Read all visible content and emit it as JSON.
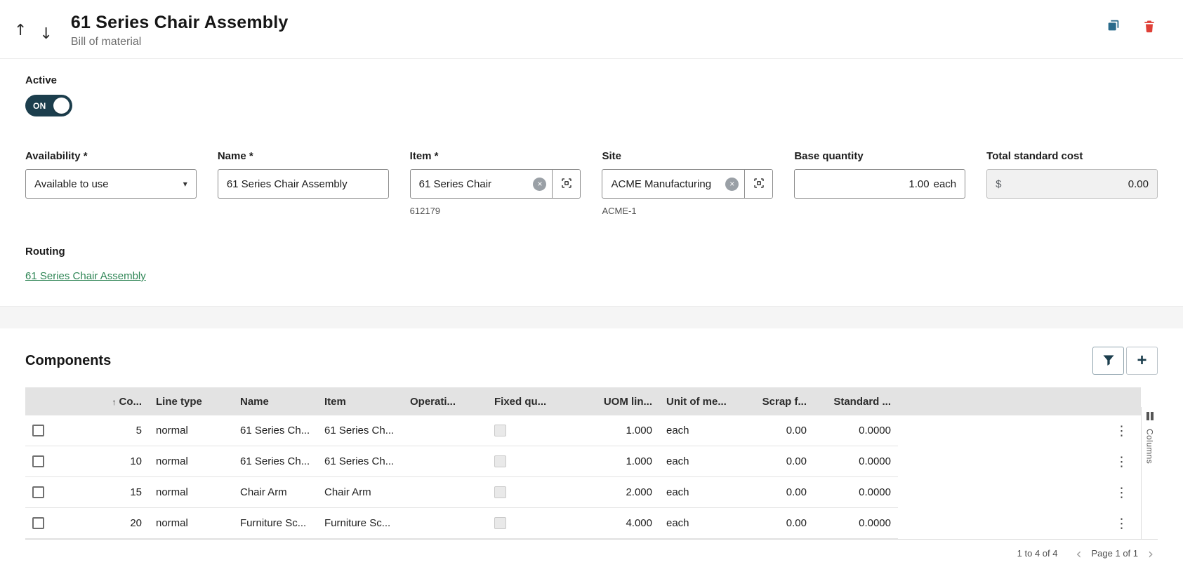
{
  "header": {
    "title": "61 Series Chair Assembly",
    "subtitle": "Bill of material"
  },
  "icons": {
    "up_arrow": "↑",
    "down_arrow": "↓",
    "select_chevron": "▾",
    "clear_x": "×",
    "kebab": "⋮",
    "chevron_left": "‹",
    "chevron_right": "›"
  },
  "active": {
    "label": "Active",
    "state": "ON"
  },
  "form": {
    "availability": {
      "label": "Availability *",
      "value": "Available to use"
    },
    "name": {
      "label": "Name *",
      "value": "61 Series Chair Assembly"
    },
    "item": {
      "label": "Item *",
      "value": "61 Series Chair",
      "helper": "612179"
    },
    "site": {
      "label": "Site",
      "value": "ACME Manufacturing",
      "helper": "ACME-1"
    },
    "base_quantity": {
      "label": "Base quantity",
      "value": "1.00",
      "suffix": "each"
    },
    "total_standard_cost": {
      "label": "Total standard cost",
      "prefix": "$",
      "value": "0.00"
    }
  },
  "routing": {
    "label": "Routing",
    "link_text": "61 Series Chair Assembly"
  },
  "components": {
    "title": "Components",
    "sort_indicator": "↑",
    "columns": [
      "Co...",
      "Line type",
      "Name",
      "Item",
      "Operati...",
      "Fixed qu...",
      "UOM lin...",
      "Unit of me...",
      "Scrap f...",
      "Standard ..."
    ],
    "rows": [
      {
        "no": "5",
        "line_type": "normal",
        "name": "61 Series Ch...",
        "item": "61 Series Ch...",
        "operation": "",
        "uom_line": "1.000",
        "unit": "each",
        "scrap": "0.00",
        "standard": "0.0000"
      },
      {
        "no": "10",
        "line_type": "normal",
        "name": "61 Series Ch...",
        "item": "61 Series Ch...",
        "operation": "",
        "uom_line": "1.000",
        "unit": "each",
        "scrap": "0.00",
        "standard": "0.0000"
      },
      {
        "no": "15",
        "line_type": "normal",
        "name": "Chair Arm",
        "item": "Chair Arm",
        "operation": "",
        "uom_line": "2.000",
        "unit": "each",
        "scrap": "0.00",
        "standard": "0.0000"
      },
      {
        "no": "20",
        "line_type": "normal",
        "name": "Furniture Sc...",
        "item": "Furniture Sc...",
        "operation": "",
        "uom_line": "4.000",
        "unit": "each",
        "scrap": "0.00",
        "standard": "0.0000"
      }
    ],
    "side_panel_label": "Columns",
    "footer": {
      "range_text": "1 to 4 of 4",
      "page_text": "Page 1 of 1"
    }
  },
  "colors": {
    "navy": "#1c3e4d",
    "link_green": "#2e8555",
    "danger_red": "#df4037",
    "copy_blue": "#2a6b8c",
    "table_header_bg": "#e3e3e3"
  }
}
